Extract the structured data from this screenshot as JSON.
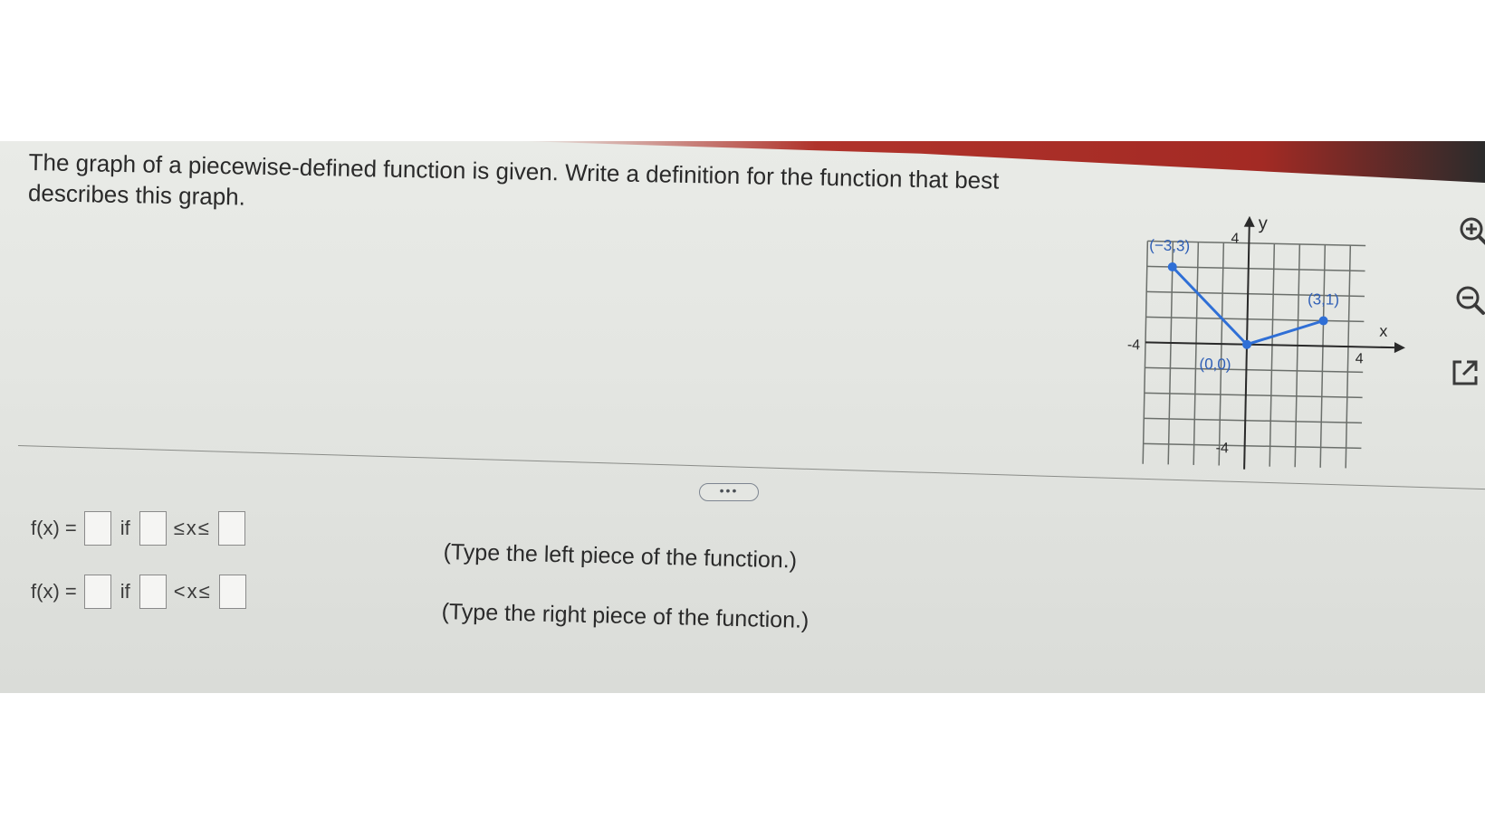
{
  "question": {
    "text": "The graph of a piecewise-defined function is given. Write a definition for the function that best describes this graph."
  },
  "graph": {
    "y_axis_label": "y",
    "x_axis_label": "x",
    "tick_left": "-4",
    "tick_right": "4",
    "tick_top": "4",
    "tick_bottom": "-4",
    "point_labels": [
      "(−3,3)",
      "(0,0)",
      "(3,1)"
    ],
    "points": [
      [
        -3,
        3
      ],
      [
        0,
        0
      ],
      [
        3,
        1
      ]
    ],
    "line_color": "#2f6fd6"
  },
  "toolbar": {
    "expand_label": "•••",
    "icons": [
      "zoom-in-icon",
      "zoom-out-icon",
      "external-link-icon"
    ]
  },
  "answers": {
    "row1": {
      "lhs": "f(x) =",
      "if": "if",
      "op": "≤x≤",
      "hint": "(Type the left piece of the function.)"
    },
    "row2": {
      "lhs": "f(x) =",
      "if": "if",
      "op": "<x≤",
      "hint": "(Type the right piece of the function.)"
    }
  }
}
